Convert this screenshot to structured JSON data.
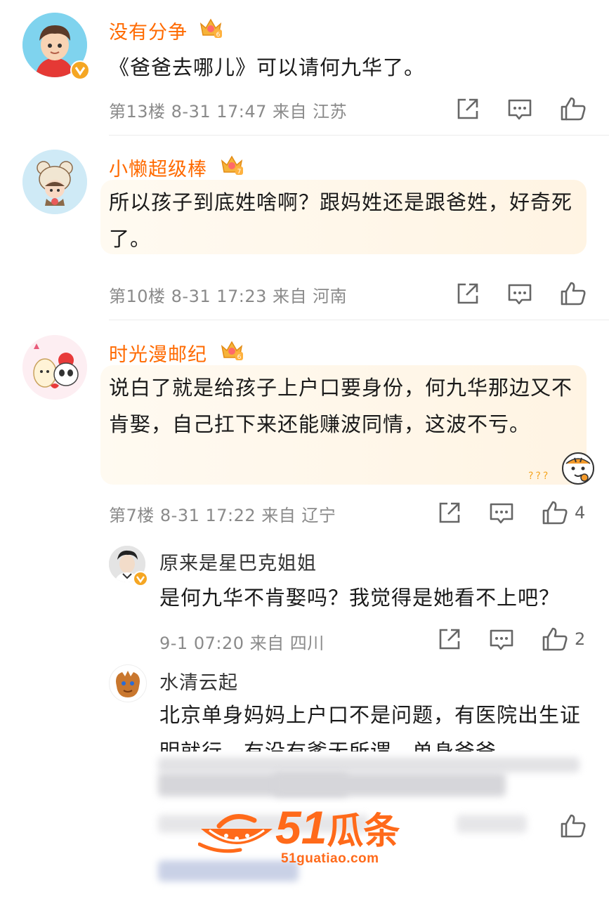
{
  "comments": [
    {
      "user": "没有分争",
      "level": "6",
      "text": "《爸爸去哪儿》可以请何九华了。",
      "meta": "第13楼 8-31 17:47 来自 江苏",
      "likes": ""
    },
    {
      "user": "小懒超级棒",
      "level": "7",
      "text": "所以孩子到底姓啥啊？跟妈姓还是跟爸姓，好奇死了。",
      "meta": "第10楼 8-31 17:23 来自 河南",
      "likes": ""
    },
    {
      "user": "时光漫邮纪",
      "level": "6",
      "text": "说白了就是给孩子上户口要身份，何九华那边又不肯娶，自己扛下来还能赚波同情，这波不亏。",
      "meta": "第7楼 8-31 17:22 来自 辽宁",
      "likes": "4",
      "sticker_text": "???"
    }
  ],
  "replies": [
    {
      "user": "原来是星巴克姐姐",
      "text": "是何九华不肯娶吗？我觉得是她看不上吧？",
      "meta": "9-1 07:20 来自 四川",
      "likes": "2"
    },
    {
      "user": "水清云起",
      "text": "北京单身妈妈上户口不是问题，有医院出生证明就行，有没有爹无所谓，单身爸爸"
    }
  ],
  "watermark": {
    "brand_num": "51",
    "brand_text": "瓜条",
    "url": "51guatiao.com"
  },
  "colors": {
    "accent": "#ff6a00",
    "gold": "#f5a623"
  },
  "icons": [
    "share-icon",
    "comment-icon",
    "like-icon",
    "crown-badge-icon",
    "verified-icon"
  ]
}
